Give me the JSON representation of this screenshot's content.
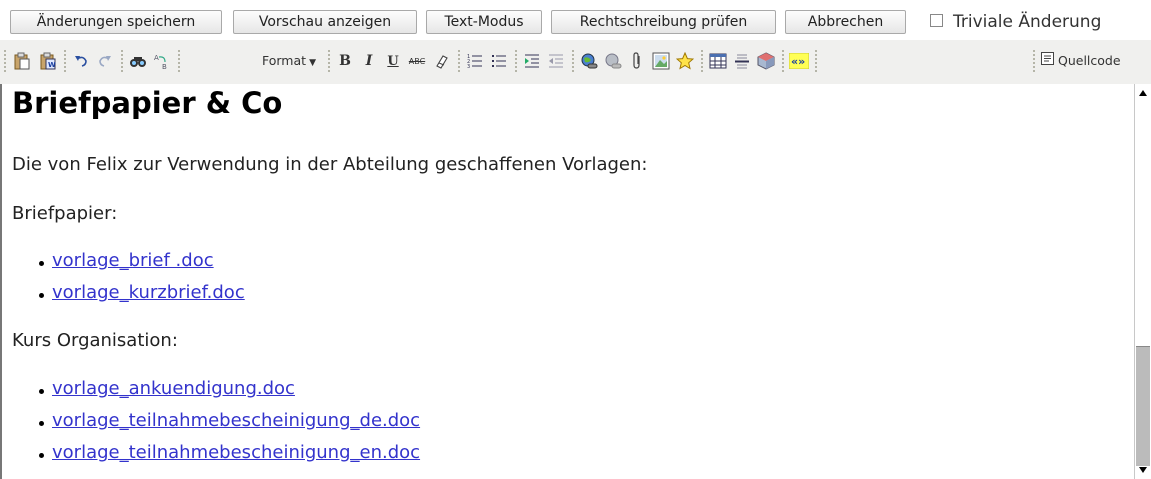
{
  "actions": {
    "save": "Änderungen speichern",
    "preview": "Vorschau anzeigen",
    "text_mode": "Text-Modus",
    "spellcheck": "Rechtschreibung prüfen",
    "cancel": "Abbrechen",
    "trivial": "Triviale Änderung",
    "trivial_checked": false
  },
  "toolbar": {
    "format_label": "Format",
    "source_label": "Quellcode",
    "icons": [
      "paste-icon",
      "paste-word-icon",
      "undo-icon",
      "redo-icon",
      "find-icon",
      "replace-icon",
      "bold-icon",
      "italic-icon",
      "underline-icon",
      "strikethrough-icon",
      "remove-format-icon",
      "ordered-list-icon",
      "unordered-list-icon",
      "indent-icon",
      "outdent-icon",
      "link-icon",
      "unlink-icon",
      "attachment-icon",
      "image-icon",
      "star-icon",
      "table-icon",
      "horizontal-rule-icon",
      "plugin-icon",
      "macro-icon",
      "source-icon"
    ]
  },
  "content": {
    "heading": "Briefpapier & Co",
    "intro": "Die von Felix zur Verwendung in der Abteilung geschaffenen Vorlagen:",
    "section1": {
      "title": "Briefpapier:",
      "links": [
        "vorlage_brief .doc",
        "vorlage_kurzbrief.doc"
      ]
    },
    "section2": {
      "title": "Kurs Organisation:",
      "links": [
        "vorlage_ankuendigung.doc",
        "vorlage_teilnahmebescheinigung_de.doc",
        "vorlage_teilnahmebescheinigung_en.doc"
      ]
    }
  },
  "colors": {
    "link": "#3333cc",
    "toolbar_bg": "#f0f0ee"
  }
}
